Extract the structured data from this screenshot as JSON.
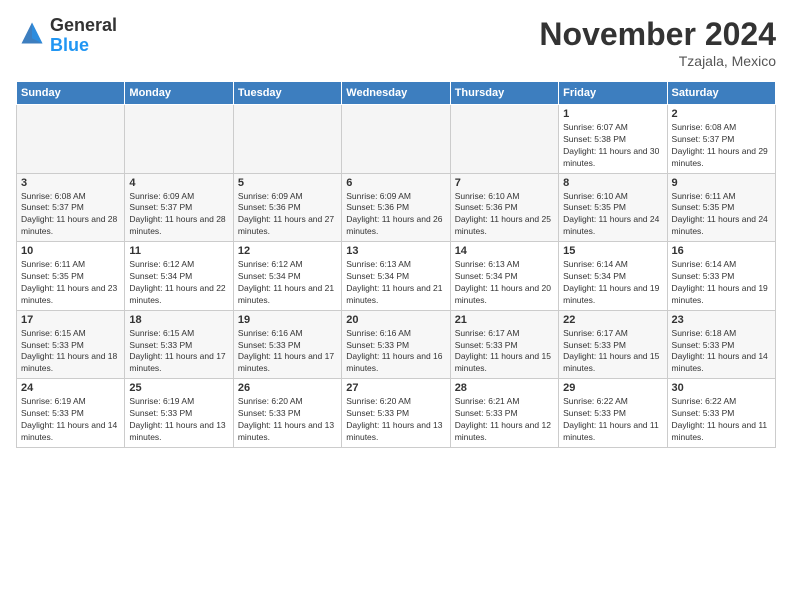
{
  "logo": {
    "general": "General",
    "blue": "Blue"
  },
  "header": {
    "month": "November 2024",
    "location": "Tzajala, Mexico"
  },
  "days_of_week": [
    "Sunday",
    "Monday",
    "Tuesday",
    "Wednesday",
    "Thursday",
    "Friday",
    "Saturday"
  ],
  "weeks": [
    [
      {
        "day": "",
        "empty": true
      },
      {
        "day": "",
        "empty": true
      },
      {
        "day": "",
        "empty": true
      },
      {
        "day": "",
        "empty": true
      },
      {
        "day": "",
        "empty": true
      },
      {
        "day": "1",
        "sunrise": "6:07 AM",
        "sunset": "5:38 PM",
        "daylight": "11 hours and 30 minutes."
      },
      {
        "day": "2",
        "sunrise": "6:08 AM",
        "sunset": "5:37 PM",
        "daylight": "11 hours and 29 minutes."
      }
    ],
    [
      {
        "day": "3",
        "sunrise": "6:08 AM",
        "sunset": "5:37 PM",
        "daylight": "11 hours and 28 minutes."
      },
      {
        "day": "4",
        "sunrise": "6:09 AM",
        "sunset": "5:37 PM",
        "daylight": "11 hours and 28 minutes."
      },
      {
        "day": "5",
        "sunrise": "6:09 AM",
        "sunset": "5:36 PM",
        "daylight": "11 hours and 27 minutes."
      },
      {
        "day": "6",
        "sunrise": "6:09 AM",
        "sunset": "5:36 PM",
        "daylight": "11 hours and 26 minutes."
      },
      {
        "day": "7",
        "sunrise": "6:10 AM",
        "sunset": "5:36 PM",
        "daylight": "11 hours and 25 minutes."
      },
      {
        "day": "8",
        "sunrise": "6:10 AM",
        "sunset": "5:35 PM",
        "daylight": "11 hours and 24 minutes."
      },
      {
        "day": "9",
        "sunrise": "6:11 AM",
        "sunset": "5:35 PM",
        "daylight": "11 hours and 24 minutes."
      }
    ],
    [
      {
        "day": "10",
        "sunrise": "6:11 AM",
        "sunset": "5:35 PM",
        "daylight": "11 hours and 23 minutes."
      },
      {
        "day": "11",
        "sunrise": "6:12 AM",
        "sunset": "5:34 PM",
        "daylight": "11 hours and 22 minutes."
      },
      {
        "day": "12",
        "sunrise": "6:12 AM",
        "sunset": "5:34 PM",
        "daylight": "11 hours and 21 minutes."
      },
      {
        "day": "13",
        "sunrise": "6:13 AM",
        "sunset": "5:34 PM",
        "daylight": "11 hours and 21 minutes."
      },
      {
        "day": "14",
        "sunrise": "6:13 AM",
        "sunset": "5:34 PM",
        "daylight": "11 hours and 20 minutes."
      },
      {
        "day": "15",
        "sunrise": "6:14 AM",
        "sunset": "5:34 PM",
        "daylight": "11 hours and 19 minutes."
      },
      {
        "day": "16",
        "sunrise": "6:14 AM",
        "sunset": "5:33 PM",
        "daylight": "11 hours and 19 minutes."
      }
    ],
    [
      {
        "day": "17",
        "sunrise": "6:15 AM",
        "sunset": "5:33 PM",
        "daylight": "11 hours and 18 minutes."
      },
      {
        "day": "18",
        "sunrise": "6:15 AM",
        "sunset": "5:33 PM",
        "daylight": "11 hours and 17 minutes."
      },
      {
        "day": "19",
        "sunrise": "6:16 AM",
        "sunset": "5:33 PM",
        "daylight": "11 hours and 17 minutes."
      },
      {
        "day": "20",
        "sunrise": "6:16 AM",
        "sunset": "5:33 PM",
        "daylight": "11 hours and 16 minutes."
      },
      {
        "day": "21",
        "sunrise": "6:17 AM",
        "sunset": "5:33 PM",
        "daylight": "11 hours and 15 minutes."
      },
      {
        "day": "22",
        "sunrise": "6:17 AM",
        "sunset": "5:33 PM",
        "daylight": "11 hours and 15 minutes."
      },
      {
        "day": "23",
        "sunrise": "6:18 AM",
        "sunset": "5:33 PM",
        "daylight": "11 hours and 14 minutes."
      }
    ],
    [
      {
        "day": "24",
        "sunrise": "6:19 AM",
        "sunset": "5:33 PM",
        "daylight": "11 hours and 14 minutes."
      },
      {
        "day": "25",
        "sunrise": "6:19 AM",
        "sunset": "5:33 PM",
        "daylight": "11 hours and 13 minutes."
      },
      {
        "day": "26",
        "sunrise": "6:20 AM",
        "sunset": "5:33 PM",
        "daylight": "11 hours and 13 minutes."
      },
      {
        "day": "27",
        "sunrise": "6:20 AM",
        "sunset": "5:33 PM",
        "daylight": "11 hours and 13 minutes."
      },
      {
        "day": "28",
        "sunrise": "6:21 AM",
        "sunset": "5:33 PM",
        "daylight": "11 hours and 12 minutes."
      },
      {
        "day": "29",
        "sunrise": "6:22 AM",
        "sunset": "5:33 PM",
        "daylight": "11 hours and 11 minutes."
      },
      {
        "day": "30",
        "sunrise": "6:22 AM",
        "sunset": "5:33 PM",
        "daylight": "11 hours and 11 minutes."
      }
    ]
  ]
}
